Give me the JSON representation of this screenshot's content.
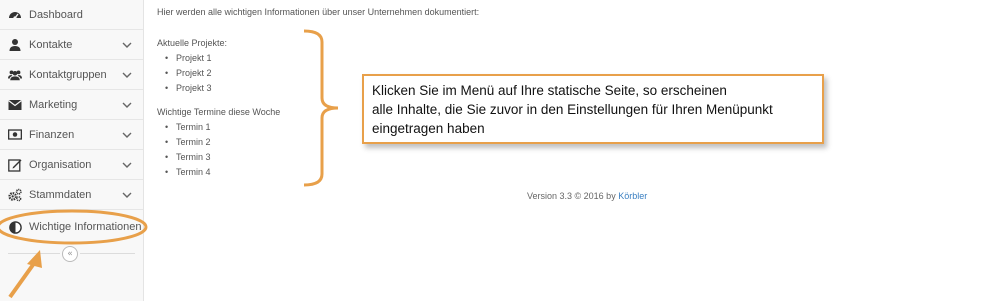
{
  "sidebar": {
    "items": [
      {
        "label": "Dashboard",
        "icon": "dashboard-icon",
        "has_chevron": false
      },
      {
        "label": "Kontakte",
        "icon": "user-icon",
        "has_chevron": true
      },
      {
        "label": "Kontaktgruppen",
        "icon": "users-icon",
        "has_chevron": true
      },
      {
        "label": "Marketing",
        "icon": "envelope-icon",
        "has_chevron": true
      },
      {
        "label": "Finanzen",
        "icon": "money-icon",
        "has_chevron": true
      },
      {
        "label": "Organisation",
        "icon": "edit-icon",
        "has_chevron": true
      },
      {
        "label": "Stammdaten",
        "icon": "cogs-icon",
        "has_chevron": true
      },
      {
        "label": "Wichtige Informationen",
        "icon": "contrast-icon",
        "has_chevron": false
      }
    ],
    "collapse_symbol": "«"
  },
  "main": {
    "intro": "Hier werden alle wichtigen Informationen über unser Unternehmen dokumentiert:",
    "sections": [
      {
        "heading": "Aktuelle Projekte:",
        "items": [
          "Projekt 1",
          "Projekt 2",
          "Projekt 3"
        ]
      },
      {
        "heading": "Wichtige Termine diese Woche",
        "items": [
          "Termin 1",
          "Termin 2",
          "Termin 3",
          "Termin 4"
        ]
      }
    ],
    "version_text": "Version 3.3 © 2016 by ",
    "version_link": "Körbler"
  },
  "callout": {
    "lines": [
      "Klicken Sie im Menü auf Ihre statische Seite, so erscheinen",
      "alle Inhalte, die Sie zuvor in den Einstellungen für Ihren Menüpunkt",
      "eingetragen haben"
    ]
  },
  "colors": {
    "annotation": "#e8a04a",
    "link": "#3a7fc1",
    "sidebar_bg": "#f8f8f8"
  }
}
